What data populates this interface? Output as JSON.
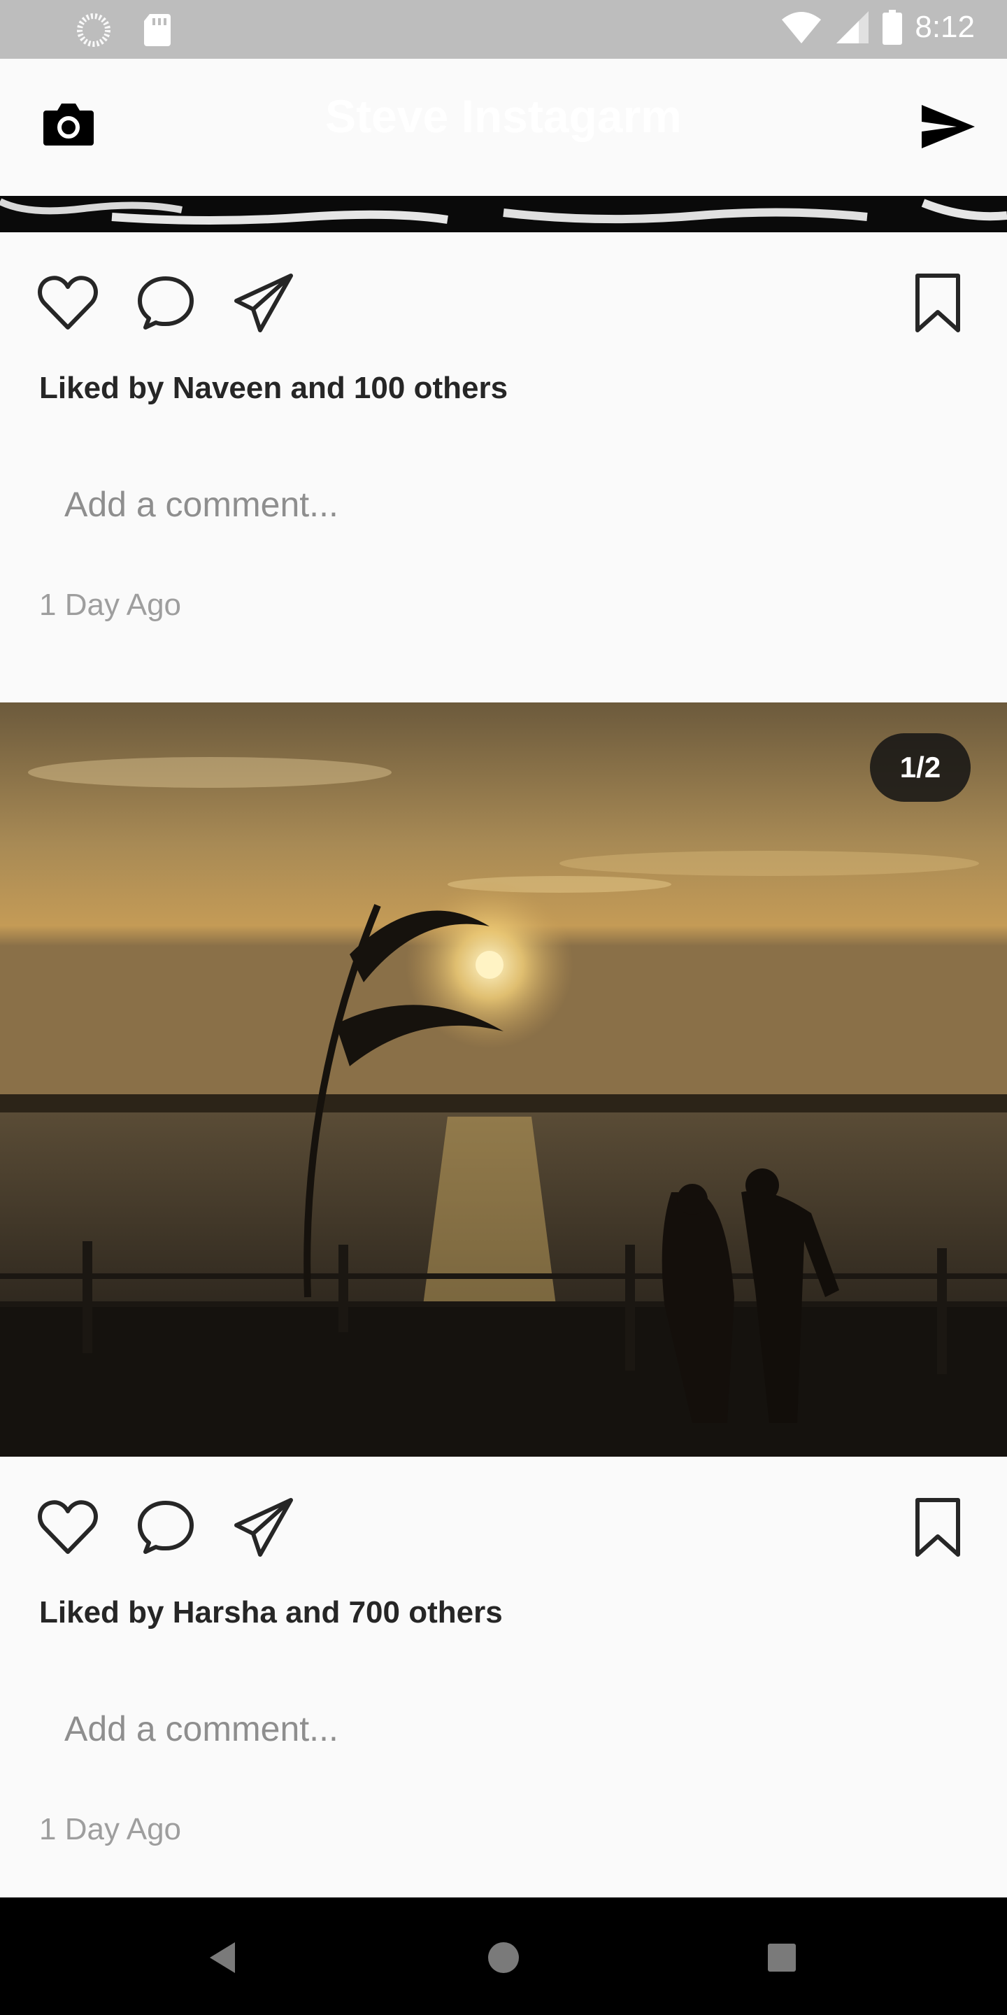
{
  "status_bar": {
    "time": "8:12",
    "icons": [
      "spinner-icon",
      "sd-card-icon",
      "wifi-icon",
      "signal-icon",
      "battery-icon"
    ]
  },
  "app_bar": {
    "title": "Steve Instagarm",
    "left_icon": "camera-icon",
    "right_icon": "send-icon"
  },
  "posts": [
    {
      "liked_by": "Liked by Naveen and 100 others",
      "comment_placeholder": "Add a comment...",
      "timestamp": "1 Day Ago"
    },
    {
      "image_counter": "1/2",
      "liked_by": "Liked by Harsha and 700 others",
      "comment_placeholder": "Add a comment...",
      "timestamp": "1 Day Ago"
    }
  ],
  "nav_bar": {
    "icons": [
      "back-icon",
      "home-icon",
      "recents-icon"
    ]
  },
  "colors": {
    "status_bar": "#bdbdbd",
    "background": "#fafafa",
    "text": "#262626",
    "muted": "#8e8e8e",
    "nav_bar": "#000000"
  }
}
